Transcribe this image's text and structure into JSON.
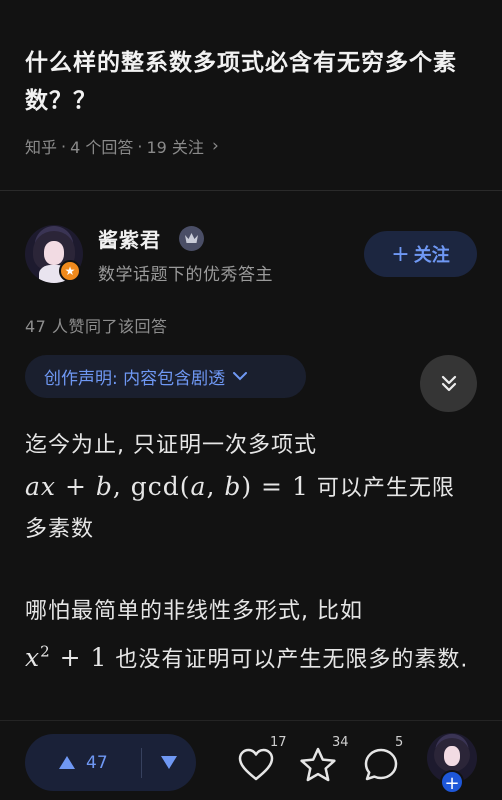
{
  "question": {
    "title": "什么样的整系数多项式必含有无穷多个素数？？",
    "source": "知乎",
    "answer_count": "4 个回答",
    "follow_count": "19 关注"
  },
  "author": {
    "name": "酱紫君",
    "description": "数学话题下的优秀答主",
    "follow_label": "关注",
    "avatar_icon": "user-avatar",
    "badge_icon": "star-badge-icon",
    "crown_icon": "crown-icon"
  },
  "answer": {
    "likes_line": "47 人赞同了该回答",
    "notice": "创作声明: 内容包含剧透",
    "para1_text": "迄今为止, 只证明一次多项式",
    "para1_math_tail": "可以产生无限多素数",
    "para2_text": "哪怕最简单的非线性多形式, 比如",
    "para2_math_tail": "也没有证明可以产生无限多的素数."
  },
  "bottom_bar": {
    "upvote_count": "47",
    "like_count": "17",
    "favorite_count": "34",
    "comment_count": "5"
  },
  "colors": {
    "background": "#121212",
    "accent": "#6f98f4",
    "badge": "#f08a1d"
  }
}
